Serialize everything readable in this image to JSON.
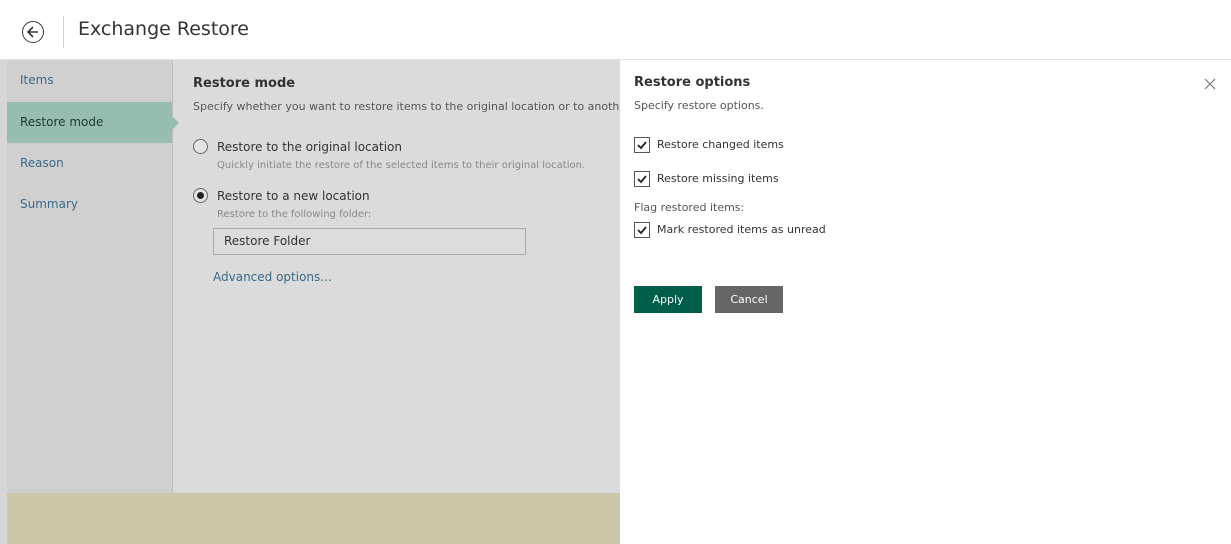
{
  "header": {
    "title": "Exchange Restore"
  },
  "nav": {
    "items": [
      {
        "label": "Items"
      },
      {
        "label": "Restore mode"
      },
      {
        "label": "Reason"
      },
      {
        "label": "Summary"
      }
    ]
  },
  "content": {
    "title": "Restore mode",
    "description": "Specify whether you want to restore items to the original location or to another locat",
    "option_original": {
      "label": "Restore to the original location",
      "description": "Quickly initiate the restore of the selected items to their original location."
    },
    "option_new": {
      "label": "Restore to a new location",
      "description": "Restore to the following folder:"
    },
    "folder_value": "Restore Folder",
    "advanced_link": "Advanced options..."
  },
  "panel": {
    "title": "Restore options",
    "description": "Specify restore options.",
    "checkboxes": [
      {
        "label": "Restore changed items",
        "checked": true
      },
      {
        "label": "Restore missing items",
        "checked": true
      }
    ],
    "flag_label": "Flag restored items:",
    "flag_checkbox": {
      "label": "Mark restored items as unread",
      "checked": true
    },
    "apply_label": "Apply",
    "cancel_label": "Cancel"
  },
  "colors": {
    "accent": "#005f4b",
    "nav_active": "#97bdb0",
    "footer": "#cdc7a9",
    "link": "#3a6a88"
  }
}
